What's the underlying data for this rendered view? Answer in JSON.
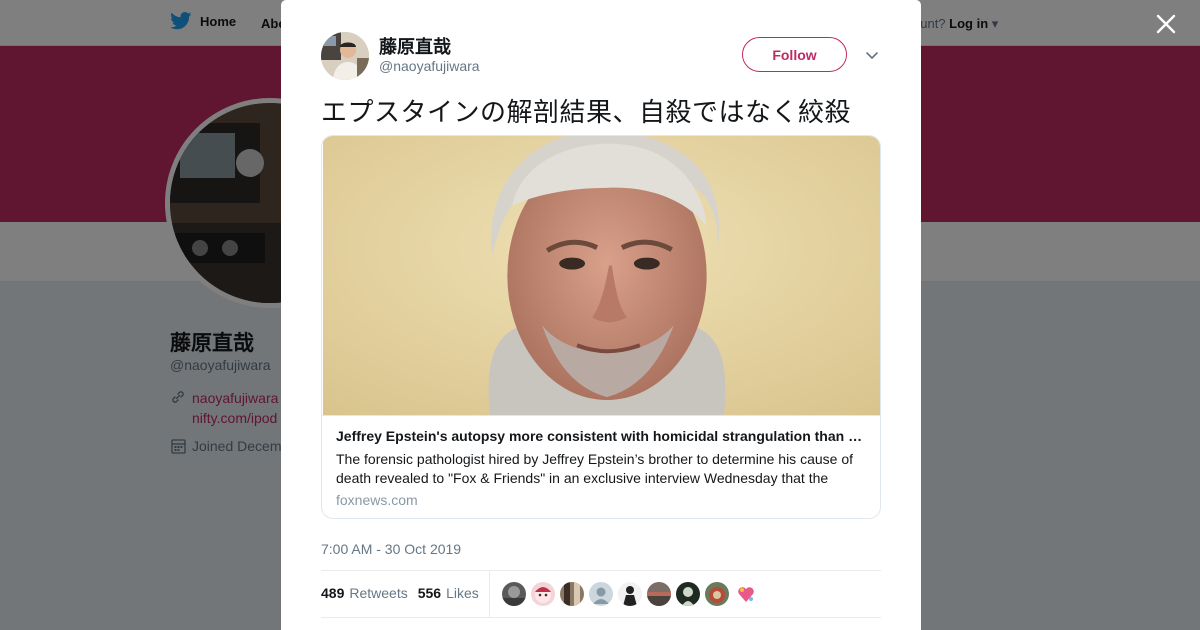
{
  "nav": {
    "home_label": "Home",
    "about_label": "Abo",
    "account_prefix": "ccount?",
    "login_label": "Log in"
  },
  "profile": {
    "name": "藤原直哉",
    "handle": "@naoyafujiwara",
    "link_line1": "naoyafujiwara",
    "link_line2": "nifty.com/ipod",
    "joined": "Joined Decem",
    "brand_color": "#c02a62"
  },
  "tweet": {
    "author_name": "藤原直哉",
    "author_handle": "@naoyafujiwara",
    "follow_label": "Follow",
    "text": "エプスタインの解剖結果、自殺ではなく絞殺",
    "card": {
      "title": "Jeffrey Epstein's autopsy more consistent with homicidal strangulation than suicide, Dr. Michael Baden reveals",
      "description": "The forensic pathologist hired by Jeffrey Epstein’s brother to determine his cause of death revealed to \"Fox & Friends\" in an exclusive interview Wednesday that the autopsy results",
      "domain": "foxnews.com"
    },
    "timestamp": "7:00 AM - 30 Oct 2019",
    "retweets_count": "489",
    "retweets_label": "Retweets",
    "likes_count": "556",
    "likes_label": "Likes"
  },
  "icons": {
    "bird": "twitter-bird-icon",
    "close": "close-icon",
    "caret": "chevron-down-icon",
    "link": "link-icon",
    "calendar": "calendar-icon"
  }
}
